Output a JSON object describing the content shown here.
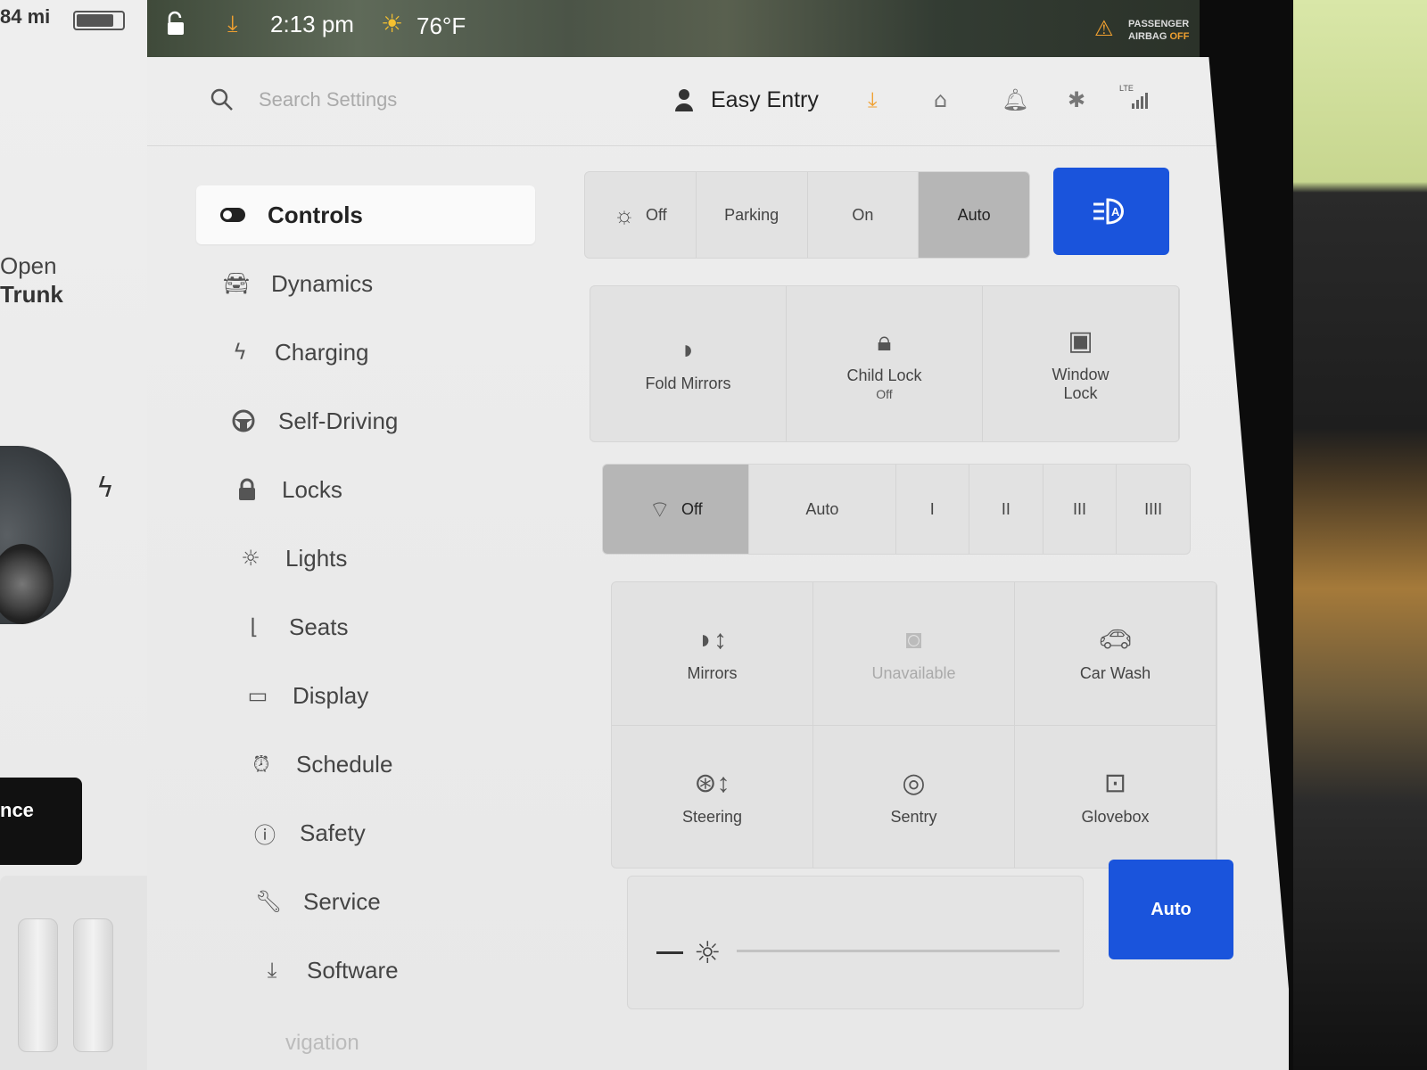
{
  "status_bar": {
    "range": "84 mi",
    "battery_level": 0.82,
    "time": "2:13 pm",
    "temperature": "76°F",
    "airbag_line1": "PASSENGER",
    "airbag_line2_a": "AIRBAG",
    "airbag_line2_b": "OFF",
    "airbag_icon": "airbag-icon"
  },
  "car_panel": {
    "trunk_line1": "Open",
    "trunk_line2": "Trunk",
    "button_partial": "nce"
  },
  "top_bar": {
    "search_placeholder": "Search Settings",
    "profile_name": "Easy Entry",
    "signal_label": "LTE",
    "icons": [
      "download-icon",
      "home-icon",
      "bell-icon",
      "bluetooth-icon",
      "signal-icon"
    ],
    "accent_color": "#f0a030"
  },
  "sidebar": {
    "items": [
      {
        "label": "Controls",
        "icon": "toggle-icon",
        "active": true
      },
      {
        "label": "Dynamics",
        "icon": "car-icon"
      },
      {
        "label": "Charging",
        "icon": "bolt-icon"
      },
      {
        "label": "Self-Driving",
        "icon": "steering-wheel-icon"
      },
      {
        "label": "Locks",
        "icon": "lock-icon"
      },
      {
        "label": "Lights",
        "icon": "sun-icon"
      },
      {
        "label": "Seats",
        "icon": "seat-icon"
      },
      {
        "label": "Display",
        "icon": "display-icon"
      },
      {
        "label": "Schedule",
        "icon": "alarm-clock-icon"
      },
      {
        "label": "Safety",
        "icon": "alert-circle-icon"
      },
      {
        "label": "Service",
        "icon": "wrench-icon"
      },
      {
        "label": "Software",
        "icon": "download-icon"
      }
    ],
    "next_partial": "vigation"
  },
  "controls": {
    "lights": {
      "options": [
        "Off",
        "Parking",
        "On",
        "Auto"
      ],
      "selected": "Auto",
      "headlight_button_icon": "auto-high-beam-icon",
      "headlight_button_color": "#1a54dc"
    },
    "row1": [
      {
        "label": "Fold Mirrors",
        "icon": "mirror-icon"
      },
      {
        "label": "Child Lock",
        "sub": "Off",
        "icon": "child-icon"
      },
      {
        "label": "Window",
        "label2": "Lock",
        "icon": "window-lock-icon"
      }
    ],
    "wipers": {
      "options": [
        "Off",
        "Auto",
        "I",
        "II",
        "III",
        "IIII"
      ],
      "selected": "Off"
    },
    "row3": [
      {
        "label": "Mirrors",
        "icon": "mirror-adjust-icon"
      },
      {
        "label": "Unavailable",
        "icon": "camera-icon",
        "disabled": true
      },
      {
        "label": "Car Wash",
        "icon": "car-wash-icon"
      },
      {
        "label": "Steering",
        "icon": "steering-adjust-icon"
      },
      {
        "label": "Sentry",
        "icon": "sentry-icon"
      },
      {
        "label": "Glovebox",
        "icon": "glovebox-icon"
      }
    ],
    "brightness": {
      "level": 0.0,
      "auto_label": "Auto",
      "auto_color": "#1a54dc"
    }
  }
}
